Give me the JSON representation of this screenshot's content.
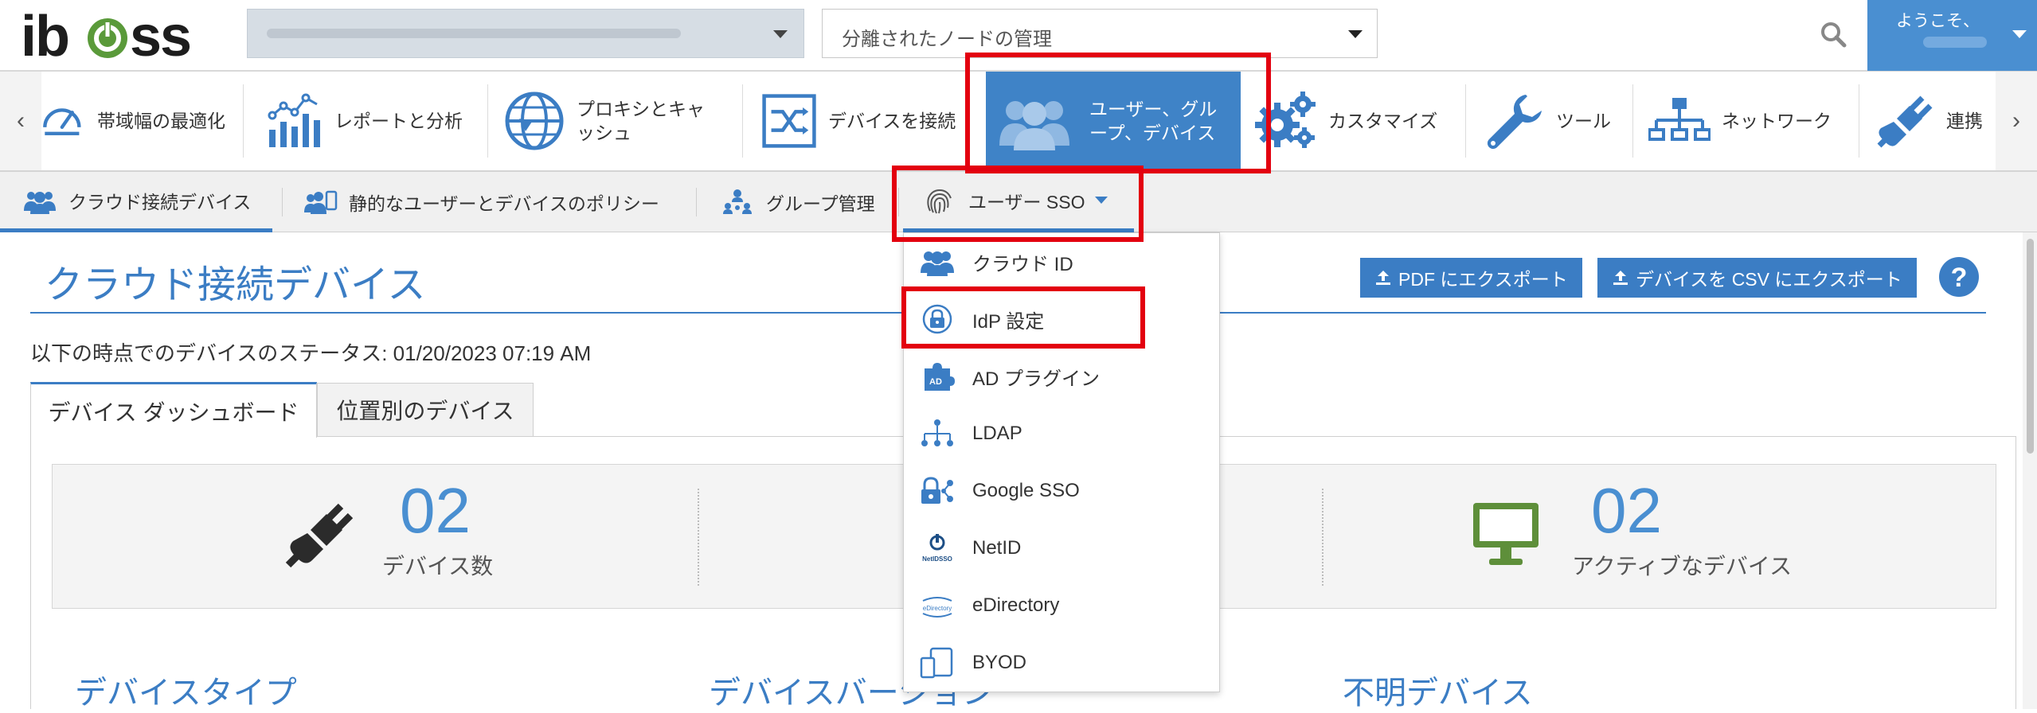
{
  "header": {
    "logo": "iboss",
    "node_select_value": "分離されたノードの管理",
    "welcome_label": "ようこそ、"
  },
  "mainnav": {
    "items": [
      {
        "label": "帯域幅の最適化",
        "icon": "gauge-icon"
      },
      {
        "label": "レポートと分析",
        "icon": "chart-icon"
      },
      {
        "label": "プロキシとキャッシュ",
        "label_lines": [
          "プロキシとキャ",
          "ッシュ"
        ],
        "icon": "globe-icon"
      },
      {
        "label": "デバイスを接続",
        "icon": "shuffle-icon"
      },
      {
        "label": "ユーザー、グループ、デバイス",
        "label_lines": [
          "ユーザー、グル",
          "ープ、デバイス"
        ],
        "icon": "users-icon"
      },
      {
        "label": "カスタマイズ",
        "icon": "gears-icon"
      },
      {
        "label": "ツール",
        "icon": "wrench-icon"
      },
      {
        "label": "ネットワーク",
        "icon": "network-icon"
      },
      {
        "label": "連携",
        "icon": "plug-icon"
      }
    ]
  },
  "subnav": {
    "items": [
      {
        "label": "クラウド接続デバイス"
      },
      {
        "label": "静的なユーザーとデバイスのポリシー"
      },
      {
        "label": "グループ管理"
      },
      {
        "label": "ユーザー SSO"
      }
    ]
  },
  "dropdown": {
    "items": [
      {
        "label": "クラウド ID",
        "icon": "users-icon"
      },
      {
        "label": "IdP 設定",
        "icon": "lock-icon"
      },
      {
        "label": "AD プラグイン",
        "icon": "puzzle-icon",
        "icon_text": "AD"
      },
      {
        "label": "LDAP",
        "icon": "hierarchy-icon"
      },
      {
        "label": "Google SSO",
        "icon": "lock-share-icon"
      },
      {
        "label": "NetID",
        "icon": "netid-icon",
        "icon_text": "NetIDSSO"
      },
      {
        "label": "eDirectory",
        "icon": "edirectory-icon",
        "icon_text": "eDirectory"
      },
      {
        "label": "BYOD",
        "icon": "devices-icon"
      }
    ]
  },
  "content": {
    "title": "クラウド接続デバイス",
    "export_pdf": "PDF にエクスポート",
    "export_csv": "デバイスを CSV にエクスポート",
    "status_line": "以下の時点でのデバイスのステータス: 01/20/2023 07:19 AM",
    "tabs": [
      "デバイス ダッシュボード",
      "位置別のデバイス"
    ],
    "stats": [
      {
        "value": "02",
        "label": "デバイス数"
      },
      {
        "value": "02",
        "label": "アクティブなデバイス"
      }
    ],
    "sections": [
      "デバイスタイプ",
      "デバイスバージョン",
      "不明デバイス"
    ]
  },
  "colors": {
    "accent": "#3b7dc4",
    "highlight": "#e3000f",
    "logo_green": "#5a9a3a",
    "monitor_green": "#5e8f3a"
  }
}
